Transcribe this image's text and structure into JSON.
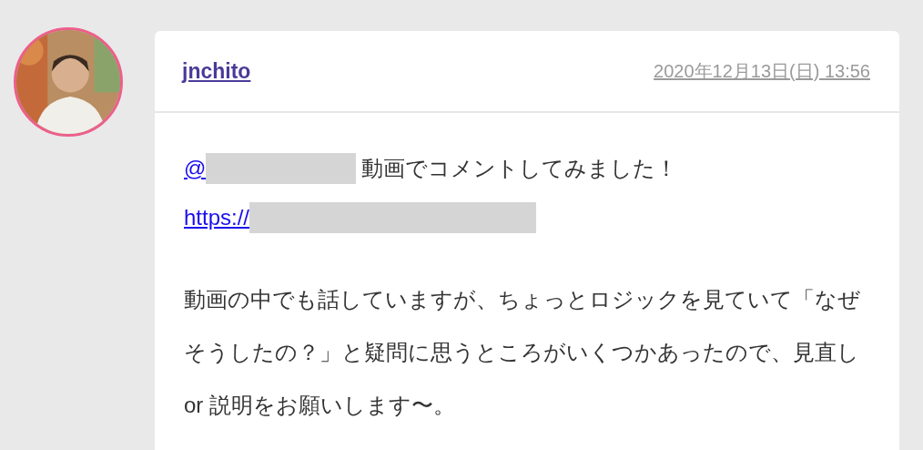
{
  "comment": {
    "author": "jnchito",
    "date": "2020年12月13日(日) 13:56",
    "lines": [
      [
        {
          "kind": "link",
          "text": "@"
        },
        {
          "kind": "redacted"
        },
        {
          "kind": "text",
          "text": "動画でコメントしてみました！"
        }
      ],
      [
        {
          "kind": "link",
          "text": "https://"
        },
        {
          "kind": "redacted"
        }
      ]
    ],
    "paragraph": "動画の中でも話していますが、ちょっとロジックを見ていて「なぜそうしたの？」と疑問に思うところがいくつかあったので、見直し or 説明をお願いします〜。"
  }
}
